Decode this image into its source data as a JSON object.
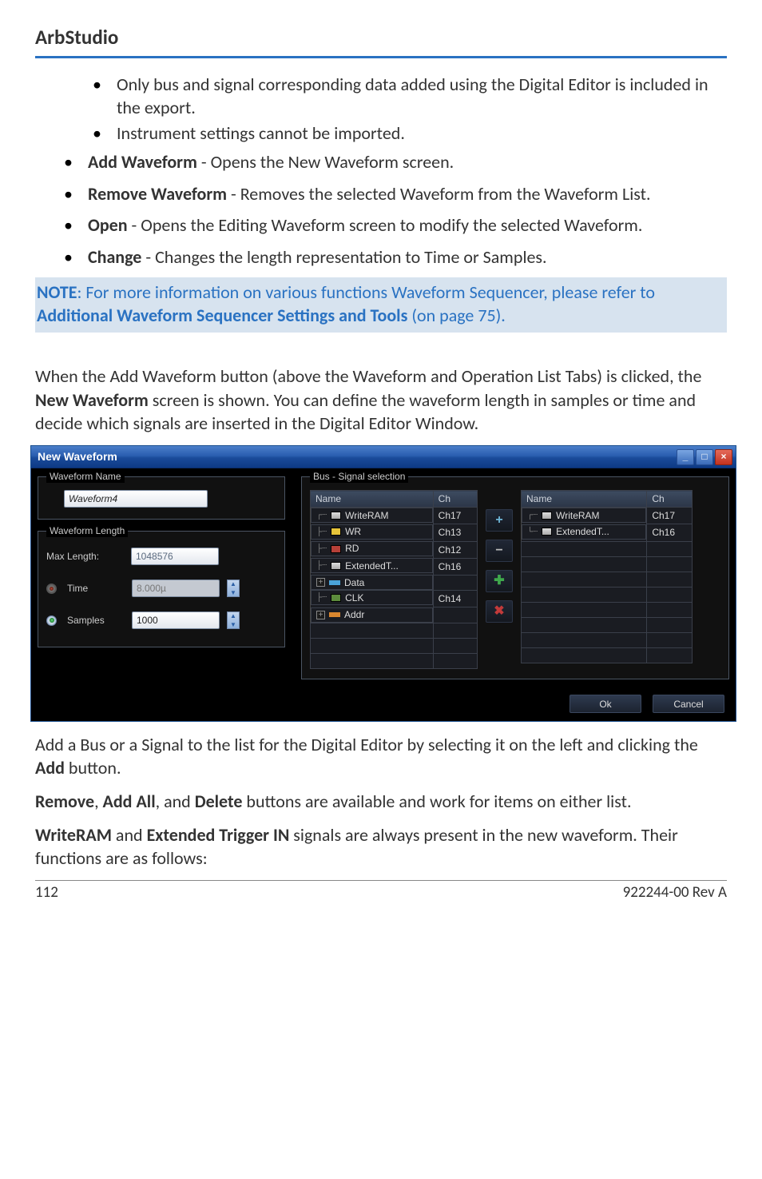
{
  "page": {
    "header": "ArbStudio",
    "footer_left": "112",
    "footer_right": "922244-00 Rev A"
  },
  "bullets": {
    "inner": [
      "Only bus and signal corresponding data added using the Digital Editor is included in the export.",
      "Instrument settings cannot be imported."
    ],
    "outer": [
      {
        "bold": "Add Waveform",
        "text": " - Opens the New Waveform screen."
      },
      {
        "bold": "Remove Waveform",
        "text": " - Removes the selected Waveform from the Waveform List."
      },
      {
        "bold": "Open",
        "text": " - Opens the Editing Waveform screen to modify the selected Waveform."
      },
      {
        "bold": "Change",
        "text": " - Changes the length representation to Time or Samples."
      }
    ]
  },
  "note": {
    "prefix": "NOTE",
    "body1": ": For more information on various functions Waveform Sequencer, please refer to ",
    "bold": "Additional Waveform Sequencer Settings and Tools",
    "body2": " (on page 75)."
  },
  "para1": {
    "a": "When the Add Waveform button (above the Waveform and Operation List Tabs) is clicked, the ",
    "bold": "New Waveform",
    "b": " screen is shown. You can define the waveform length in samples or time and decide which signals are inserted in the Digital Editor Window."
  },
  "para2": {
    "a": "Add a Bus or a Signal to the list for the Digital Editor by selecting it on the left and clicking the ",
    "bold": "Add",
    "b": " button."
  },
  "para3": {
    "b1": "Remove",
    "t1": ", ",
    "b2": "Add All",
    "t2": ", and ",
    "b3": "Delete",
    "t3": " buttons are available and work for items on either list."
  },
  "para4": {
    "b1": "WriteRAM",
    "t1": " and ",
    "b2": "Extended Trigger IN",
    "t2": " signals are always present in the new waveform. Their functions are as follows:"
  },
  "dialog": {
    "title": "New Waveform",
    "left": {
      "name_legend": "Waveform Name",
      "name_value": "Waveform4",
      "length_legend": "Waveform Length",
      "max_label": "Max Length:",
      "max_value": "1048576",
      "time_label": "Time",
      "time_value": "8.000µ",
      "samples_label": "Samples",
      "samples_value": "1000"
    },
    "bus": {
      "legend": "Bus - Signal selection",
      "headers": {
        "name": "Name",
        "ch": "Ch"
      },
      "left_rows": [
        {
          "name": "WriteRAM",
          "ch": "Ch17",
          "icon": "gray"
        },
        {
          "name": "WR",
          "ch": "Ch13",
          "icon": "yellow"
        },
        {
          "name": "RD",
          "ch": "Ch12",
          "icon": "red"
        },
        {
          "name": "ExtendedT...",
          "ch": "Ch16",
          "icon": "gray"
        },
        {
          "name": "Data",
          "ch": "",
          "icon": "eqblue"
        },
        {
          "name": "CLK",
          "ch": "Ch14",
          "icon": "green"
        },
        {
          "name": "Addr",
          "ch": "",
          "icon": "eqorange"
        }
      ],
      "right_rows": [
        {
          "name": "WriteRAM",
          "ch": "Ch17",
          "icon": "gray"
        },
        {
          "name": "ExtendedT...",
          "ch": "Ch16",
          "icon": "gray"
        }
      ],
      "ok": "Ok",
      "cancel": "Cancel"
    }
  }
}
